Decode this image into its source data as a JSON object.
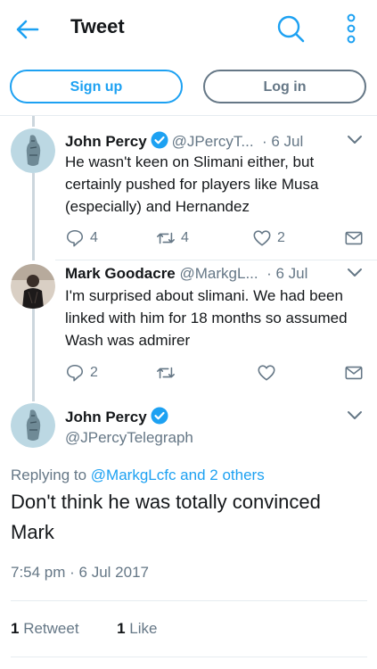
{
  "header": {
    "title": "Tweet",
    "back_icon": "back-arrow-icon",
    "search_icon": "search-icon",
    "more_icon": "more-vertical-icon"
  },
  "auth": {
    "signup_label": "Sign up",
    "login_label": "Log in"
  },
  "colors": {
    "accent": "#1da1f2",
    "secondary_text": "#657786",
    "divider": "#e6ecf0"
  },
  "tweets": [
    {
      "name": "John Percy",
      "verified": true,
      "handle": "@JPercyT...",
      "time": "· 6 Jul",
      "text": "He wasn't keen on Slimani either, but certainly pushed for players like Musa (especially) and Hernandez",
      "replies": "4",
      "retweets": "4",
      "likes": "2"
    },
    {
      "name": "Mark Goodacre",
      "verified": false,
      "handle": "@MarkgL...",
      "time": "· 6 Jul",
      "text": "I'm surprised about slimani. We had been linked with him for 18 months so assumed Wash was admirer",
      "replies": "2",
      "retweets": "",
      "likes": ""
    }
  ],
  "main_tweet": {
    "name": "John Percy",
    "verified": true,
    "handle": "@JPercyTelegraph",
    "replying_prefix": "Replying to",
    "replying_to": "@MarkgLcfc and 2 others",
    "text": "Don't think he was totally convinced Mark",
    "timestamp": "7:54 pm · 6 Jul 2017",
    "retweet_count": "1",
    "retweet_label": "Retweet",
    "like_count": "1",
    "like_label": "Like"
  }
}
